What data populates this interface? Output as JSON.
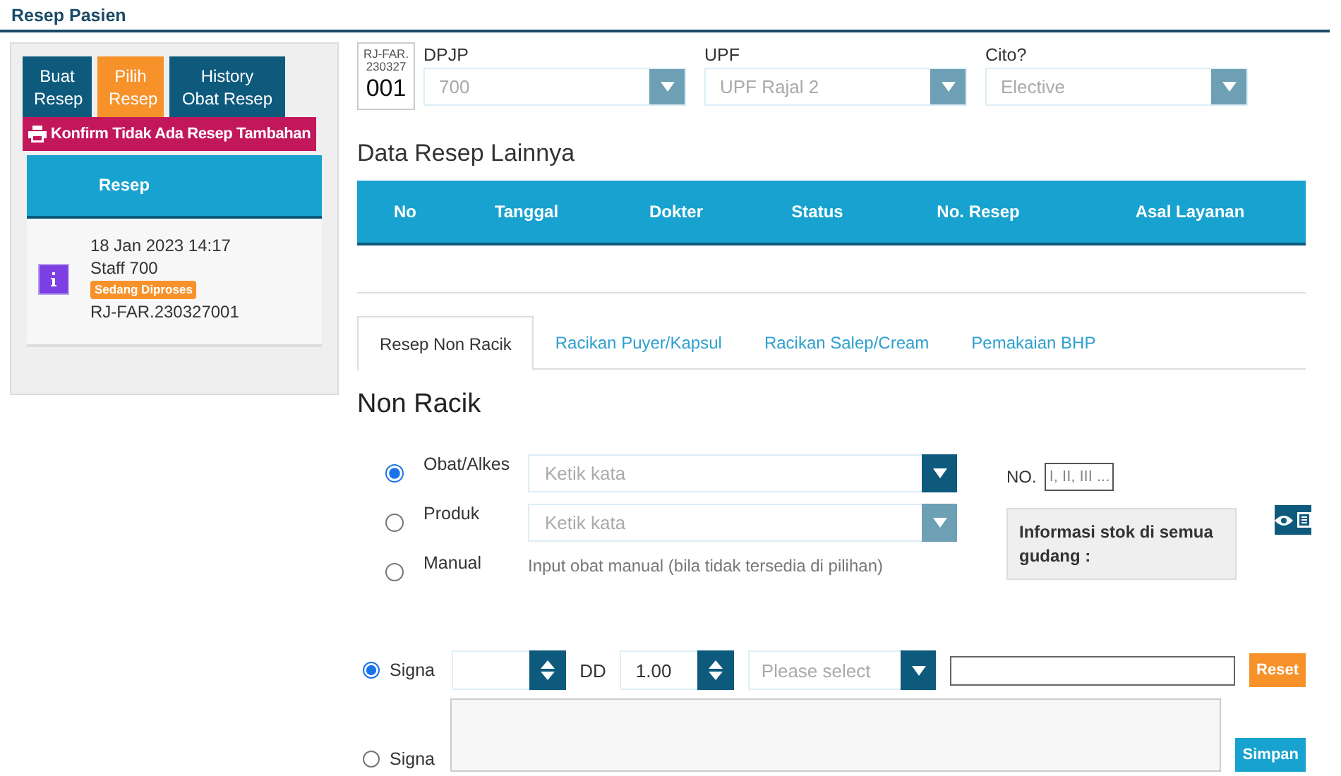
{
  "page_title": "Resep Pasien",
  "left_tabs": [
    {
      "label": "Buat Resep",
      "selected": false
    },
    {
      "label": "Pilih Resep",
      "selected": true
    },
    {
      "label": "History Obat Resep",
      "selected": false
    }
  ],
  "confirm_button": "Konfirm Tidak Ada Resep Tambahan",
  "resep_list": {
    "header": "Resep",
    "items": [
      {
        "date": "18 Jan 2023 14:17",
        "staff": "Staff 700",
        "status": "Sedang Diproses",
        "number": "RJ-FAR.230327001"
      }
    ]
  },
  "resep_badge": {
    "prefix": "RJ-FAR.",
    "date": "230327",
    "number": "001"
  },
  "selects": [
    {
      "label": "DPJP",
      "value": "700",
      "disabled": true
    },
    {
      "label": "UPF",
      "value": "UPF Rajal 2",
      "disabled": true
    },
    {
      "label": "Cito?",
      "value": "Elective",
      "disabled": true
    }
  ],
  "other_resep": {
    "title": "Data Resep Lainnya",
    "columns": [
      "No",
      "Tanggal",
      "Dokter",
      "Status",
      "No. Resep",
      "Asal Layanan"
    ]
  },
  "tabs": [
    {
      "label": "Resep Non Racik",
      "selected": true
    },
    {
      "label": "Racikan Puyer/Kapsul",
      "selected": false
    },
    {
      "label": "Racikan Salep/Cream",
      "selected": false
    },
    {
      "label": "Pemakaian BHP",
      "selected": false
    }
  ],
  "section_title": "Non Racik",
  "item_sources": [
    {
      "kind": "select",
      "label": "Obat/Alkes",
      "selected": true,
      "placeholder": "Ketik kata",
      "disabled": false
    },
    {
      "kind": "select",
      "label": "Produk",
      "selected": false,
      "placeholder": "Ketik kata",
      "disabled": true
    },
    {
      "kind": "note",
      "label": "Manual",
      "selected": false,
      "note": "Input obat manual (bila tidak tersedia di pilihan)"
    }
  ],
  "no_field": {
    "label": "NO.",
    "placeholder": "I, II, III ..."
  },
  "stock_info": "Informasi stok di semua gudang :",
  "signa_rows": [
    {
      "kind": "dose",
      "label": "Signa",
      "selected": true,
      "dd_label": "DD",
      "dd_value": "1.00",
      "select_placeholder": "Please select",
      "button": "Reset"
    },
    {
      "kind": "text",
      "label": "Signa",
      "selected": false,
      "button": "Simpan"
    }
  ]
}
